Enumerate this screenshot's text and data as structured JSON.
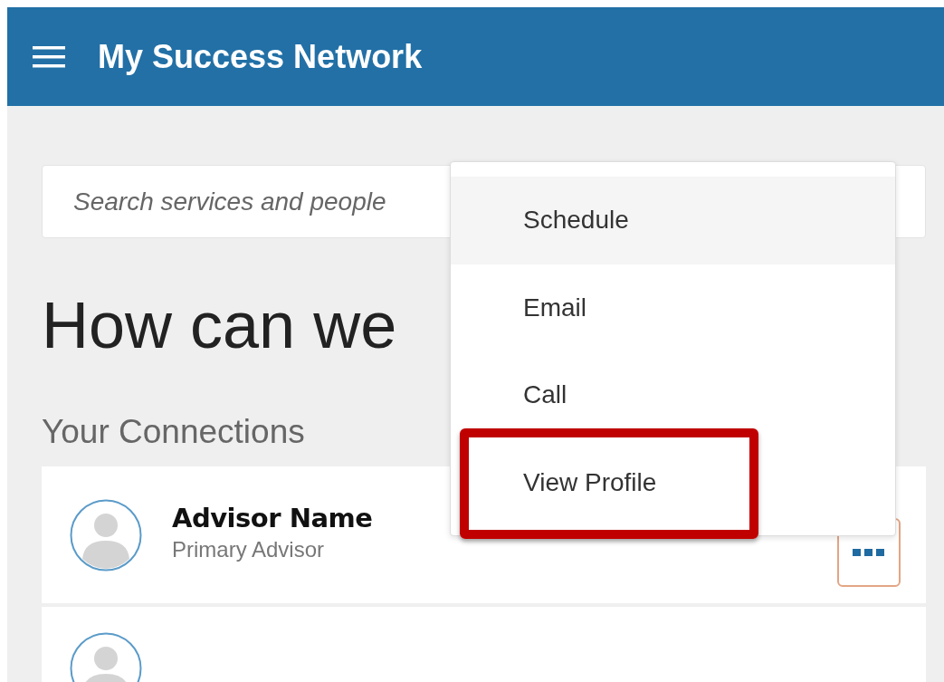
{
  "header": {
    "title": "My Success Network"
  },
  "search": {
    "placeholder": "Search services and people"
  },
  "heading": "How can we",
  "connections_title": "Your Connections",
  "connections": [
    {
      "kind": "full",
      "name": "Advisor Name",
      "role": "Primary Advisor"
    },
    {
      "kind": "cut-off"
    }
  ],
  "menu": {
    "items": [
      {
        "label": "Schedule",
        "highlighted": true,
        "annotated": false
      },
      {
        "label": "Email",
        "highlighted": false,
        "annotated": false
      },
      {
        "label": "Call",
        "highlighted": false,
        "annotated": false
      },
      {
        "label": "View Profile",
        "highlighted": false,
        "annotated": true
      }
    ]
  }
}
